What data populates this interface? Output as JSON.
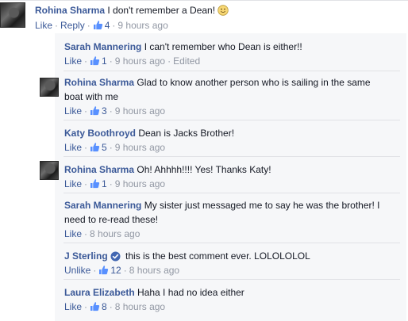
{
  "icons": {
    "like": "thumbs-up-icon",
    "verified": "verified-badge-icon",
    "emoji": "smile-emoji-icon"
  },
  "colors": {
    "link": "#3b5998",
    "meta": "#9197a3",
    "reply_bg": "#f6f7f9",
    "verified": "#4267b2"
  },
  "comments": [
    {
      "name": "Rohina Sharma",
      "text": "I don't remember a Dean!",
      "actions": [
        "Like",
        "Reply"
      ],
      "likes": "4",
      "time": "9 hours ago"
    },
    {
      "name": "Sarah Mannering",
      "text": "I can't remember who Dean is either!!",
      "actions": [
        "Like"
      ],
      "likes": "1",
      "time": "9 hours ago",
      "edited": "Edited"
    },
    {
      "name": "Rohina Sharma",
      "text": "Glad to know another person who is sailing in the same boat with me",
      "actions": [
        "Like"
      ],
      "likes": "3",
      "time": "9 hours ago"
    },
    {
      "name": "Katy Boothroyd",
      "text": "Dean is Jacks Brother!",
      "actions": [
        "Like"
      ],
      "likes": "5",
      "time": "9 hours ago"
    },
    {
      "name": "Rohina Sharma",
      "text": "Oh! Ahhhh!!!! Yes! Thanks Katy!",
      "actions": [
        "Like"
      ],
      "likes": "1",
      "time": "9 hours ago"
    },
    {
      "name": "Sarah Mannering",
      "text": "My sister just messaged me to say he was the brother! I need to re-read these!",
      "actions": [
        "Like"
      ],
      "time": "8 hours ago"
    },
    {
      "name": "J Sterling",
      "text": "this is the best comment ever. LOLOLOLOL",
      "actions": [
        "Unlike"
      ],
      "likes": "12",
      "time": "8 hours ago",
      "verified": true
    },
    {
      "name": "Laura Elizabeth",
      "text": "Haha I had no idea either",
      "actions": [
        "Like"
      ],
      "likes": "8",
      "time": "8 hours ago"
    }
  ]
}
